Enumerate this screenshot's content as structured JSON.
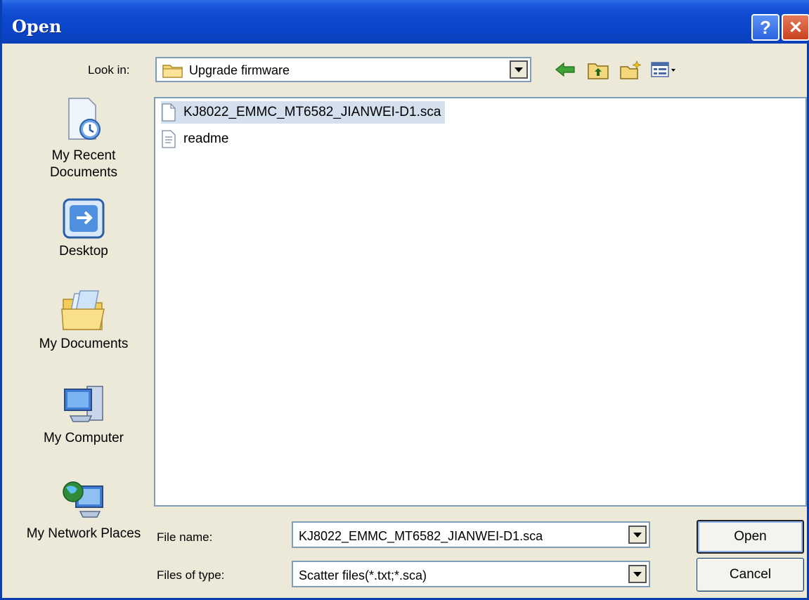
{
  "window": {
    "title": "Open"
  },
  "titlebar": {
    "help_symbol": "?",
    "close_symbol": "✕"
  },
  "look_in": {
    "label": "Look in:",
    "value": "Upgrade firmware"
  },
  "toolbar": {
    "icons": [
      "back-icon",
      "up-folder-icon",
      "new-folder-icon",
      "view-menu-icon"
    ]
  },
  "places": [
    {
      "label": "My Recent Documents",
      "icon": "recent-documents-icon"
    },
    {
      "label": "Desktop",
      "icon": "desktop-icon"
    },
    {
      "label": "My Documents",
      "icon": "my-documents-icon"
    },
    {
      "label": "My Computer",
      "icon": "my-computer-icon"
    },
    {
      "label": "My Network Places",
      "icon": "network-places-icon"
    }
  ],
  "files": [
    {
      "name": "KJ8022_EMMC_MT6582_JIANWEI-D1.sca",
      "selected": true,
      "icon": "file-icon"
    },
    {
      "name": "readme",
      "selected": false,
      "icon": "text-file-icon"
    }
  ],
  "file_name": {
    "label": "File name:",
    "value": "KJ8022_EMMC_MT6582_JIANWEI-D1.sca"
  },
  "file_type": {
    "label": "Files of type:",
    "value": "Scatter files(*.txt;*.sca)"
  },
  "buttons": {
    "open": "Open",
    "cancel": "Cancel"
  },
  "colors": {
    "titlebar": "#0a45c9",
    "dialog_bg": "#ece9d8",
    "selection": "#d5e0ef",
    "field_border": "#7f9db9"
  }
}
